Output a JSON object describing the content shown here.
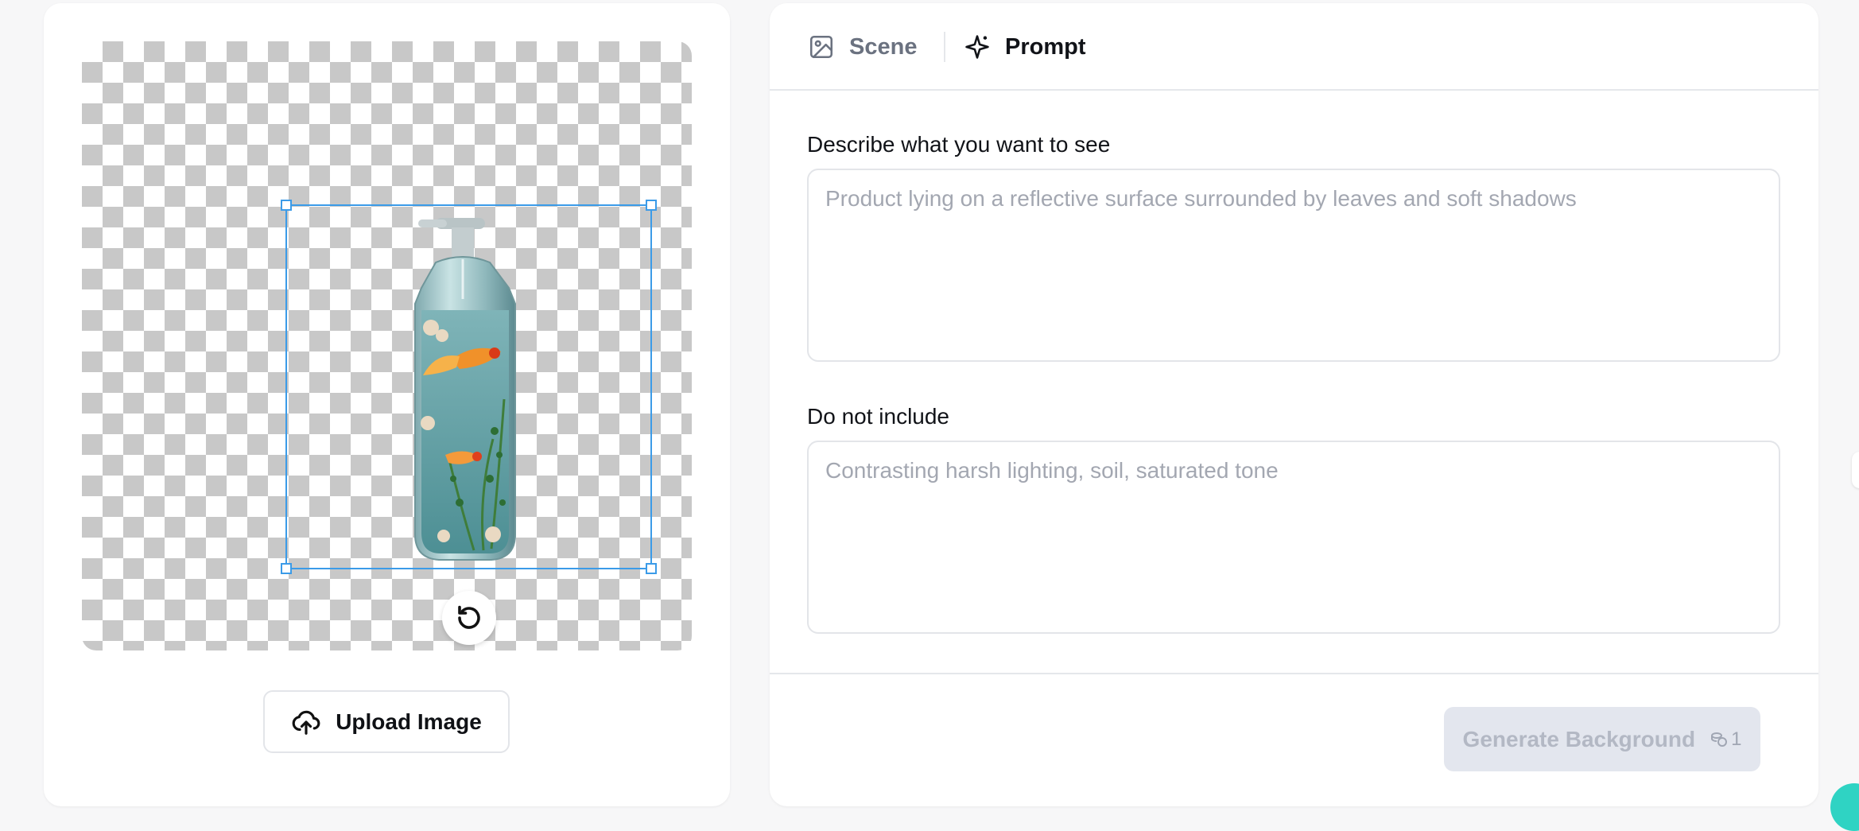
{
  "upload": {
    "label": "Upload Image"
  },
  "tabs": [
    {
      "label": "Scene",
      "icon": "image-icon",
      "active": false
    },
    {
      "label": "Prompt",
      "icon": "sparkle-icon",
      "active": true
    }
  ],
  "prompt": {
    "describe_label": "Describe what you want to see",
    "describe_placeholder": "Product lying on a reflective surface surrounded by leaves and soft shadows",
    "describe_value": "",
    "exclude_label": "Do not include",
    "exclude_placeholder": "Contrasting harsh lighting, soil, saturated tone",
    "exclude_value": ""
  },
  "generate": {
    "label": "Generate Background",
    "credit_cost": "1",
    "credit_icon": "coins-icon",
    "enabled": false
  },
  "colors": {
    "selection": "#3b9be8",
    "accent_teal": "#2fd3c3",
    "disabled_button_bg": "#e3e6ee",
    "placeholder_text": "#a3a7b1"
  }
}
